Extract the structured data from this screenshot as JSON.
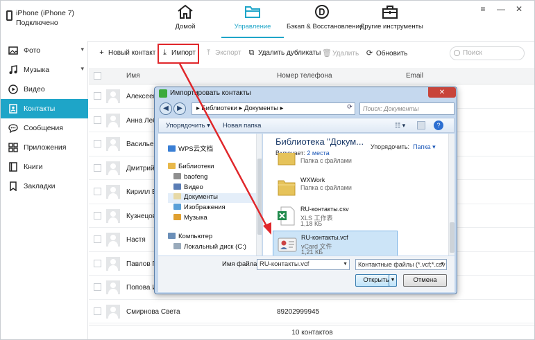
{
  "device": {
    "name": "iPhone (iPhone 7)",
    "status": "Подключено"
  },
  "nav_tabs": [
    {
      "label": "Домой",
      "icon": "home-icon"
    },
    {
      "label": "Управление",
      "icon": "folder-icon",
      "active": true
    },
    {
      "label": "Бэкап & Восстановление",
      "icon": "backup-icon"
    },
    {
      "label": "Другие инструменты",
      "icon": "toolbox-icon"
    }
  ],
  "window_controls": {
    "menu": "≡",
    "minimize": "—",
    "close": "✕"
  },
  "sidebar": {
    "items": [
      {
        "label": "Фото",
        "icon": "photo-icon",
        "arrow": "▾"
      },
      {
        "label": "Музыка",
        "icon": "music-icon",
        "arrow": "▾"
      },
      {
        "label": "Видео",
        "icon": "video-icon"
      },
      {
        "label": "Контакты",
        "icon": "contacts-icon",
        "active": true
      },
      {
        "label": "Сообщения",
        "icon": "messages-icon"
      },
      {
        "label": "Приложения",
        "icon": "apps-icon"
      },
      {
        "label": "Книги",
        "icon": "books-icon"
      },
      {
        "label": "Закладки",
        "icon": "bookmarks-icon"
      }
    ]
  },
  "toolbar": {
    "new_contact": "Новый контакт",
    "import": "Импорт",
    "export": "Экспорт",
    "dedupe": "Удалить дубликаты",
    "delete": "Удалить",
    "refresh": "Обновить",
    "search_placeholder": "Поиск"
  },
  "table": {
    "headers": {
      "name": "Имя",
      "phone": "Номер телефона",
      "email": "Email"
    },
    "rows": [
      {
        "name": "Алексеев",
        "phone": ""
      },
      {
        "name": "Анна Лебе",
        "phone": ""
      },
      {
        "name": "Васильев",
        "phone": ""
      },
      {
        "name": "Дмитрий И",
        "phone": ""
      },
      {
        "name": "Кирилл Ег",
        "phone": ""
      },
      {
        "name": "Кузнецов",
        "phone": ""
      },
      {
        "name": "Настя",
        "phone": ""
      },
      {
        "name": "Павлов П",
        "phone": ""
      },
      {
        "name": "Попова И",
        "phone": ""
      },
      {
        "name": "Смирнова Света",
        "phone": "89202999945"
      }
    ],
    "footer": "10 контактов"
  },
  "dialog": {
    "title": "Импортировать контакты",
    "close": "✕",
    "back": "◀",
    "forward": "▶",
    "path_seg1": "Библиотеки",
    "path_seg2": "Документы",
    "path_sep": "▸",
    "refresh": "⟳",
    "search_placeholder": "Поиск: Документы",
    "cmd_organize": "Упорядочить ▾",
    "cmd_new_folder": "Новая папка",
    "cmd_help": "?",
    "nav": [
      {
        "label": "WPS云文档",
        "color": "#3a7fd5"
      },
      {
        "label": "Библиотеки",
        "color": "#e8b84a"
      },
      {
        "label": "baofeng",
        "color": "#8f8f8f"
      },
      {
        "label": "Видео",
        "color": "#5a7db5"
      },
      {
        "label": "Документы",
        "color": "#e7d9a6",
        "selected": true
      },
      {
        "label": "Изображения",
        "color": "#5aa0d8"
      },
      {
        "label": "Музыка",
        "color": "#e0a030"
      },
      {
        "label": "Компьютер",
        "color": "#6b8fb8"
      },
      {
        "label": "Локальный диск (C:)",
        "color": "#9ab"
      }
    ],
    "lib_title": "Библиотека \"Докум...",
    "lib_includes_label": "Включает:",
    "lib_includes_value": "2 места",
    "lib_order_label": "Упорядочить:",
    "lib_order_value": "Папка ▾",
    "files": [
      {
        "name": "",
        "type": "Папка с файлами",
        "size": "",
        "icon": "folder-icon"
      },
      {
        "name": "WXWork",
        "type": "Папка с файлами",
        "size": "",
        "icon": "folder-icon"
      },
      {
        "name": "RU-контакты.csv",
        "type": "XLS 工作表",
        "size": "1,18 КБ",
        "icon": "xls-icon"
      },
      {
        "name": "RU-контакты.vcf",
        "type": "vCard 文件",
        "size": "1,21 КБ",
        "icon": "vcard-icon",
        "selected": true
      }
    ],
    "filename_label": "Имя файла:",
    "filename_value": "RU-контакты.vcf",
    "filetype_value": "Контактные файлы (*.vcf;*.csv",
    "open": "Открыть",
    "cancel": "Отмена"
  },
  "colors": {
    "accent": "#1ea5c8",
    "highlight": "#e0272b"
  }
}
